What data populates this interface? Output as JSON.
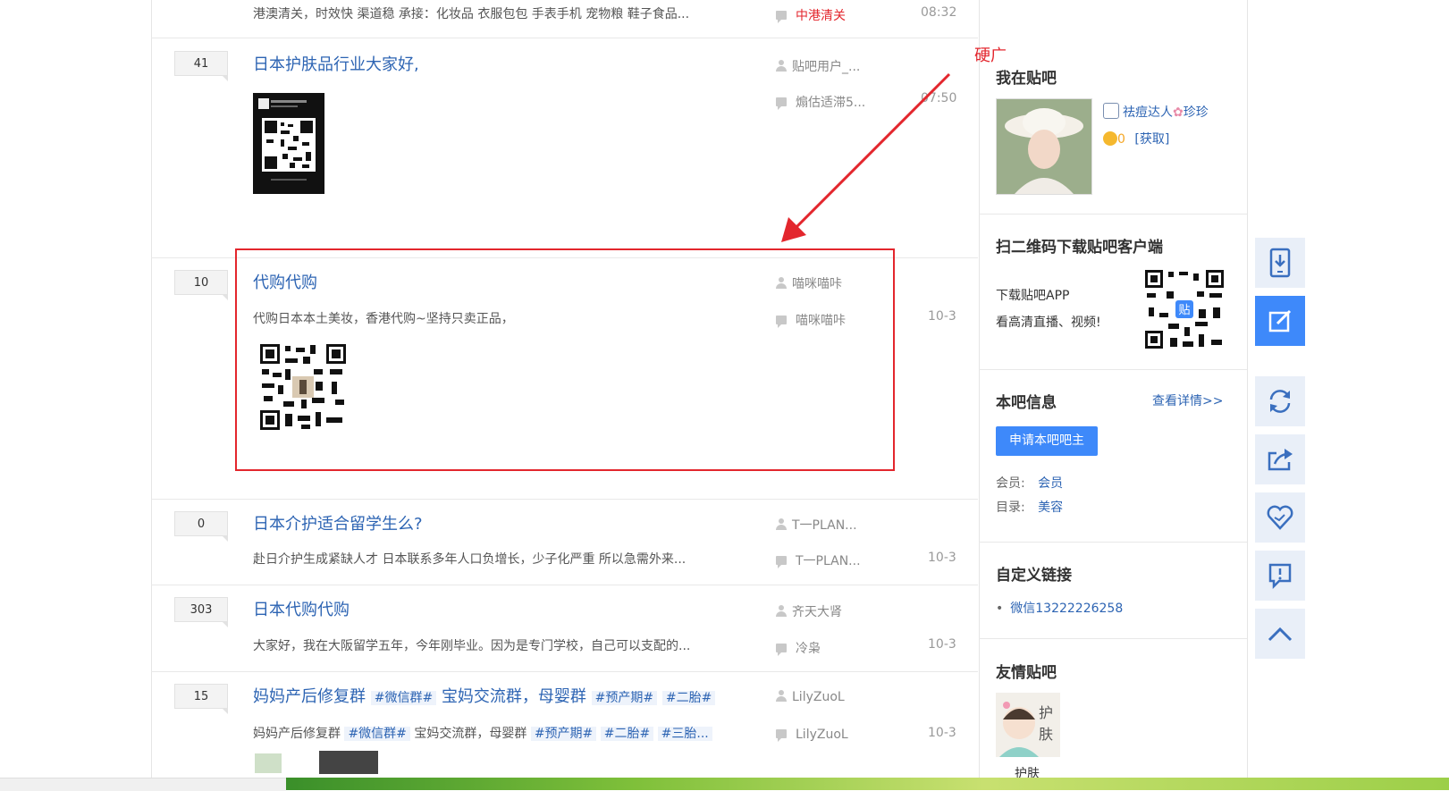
{
  "threads": [
    {
      "reply_count": "",
      "title": "",
      "abstract": "港澳清关，时效快 渠道稳 承接：化妆品 衣服包包 手表手机 宠物粮 鞋子食品...",
      "author": "",
      "last_reply": "中港清关",
      "time": "08:32"
    },
    {
      "reply_count": "41",
      "title": "日本护肤品行业大家好,",
      "abstract": "",
      "author": "贴吧用户_...",
      "last_reply": "煽估适滞5...",
      "time": "07:50"
    },
    {
      "reply_count": "10",
      "title": "代购代购",
      "abstract": "代购日本本土美妆，香港代购~坚持只卖正品，",
      "author": "喵咪喵咔",
      "last_reply": "喵咪喵咔",
      "time": "10-3"
    },
    {
      "reply_count": "0",
      "title": "日本介护适合留学生么?",
      "abstract": "赴日介护生成紧缺人才 日本联系多年人口负增长，少子化严重 所以急需外来...",
      "author": "T一PLAN...",
      "last_reply": "T一PLAN...",
      "time": "10-3"
    },
    {
      "reply_count": "303",
      "title": "日本代购代购",
      "abstract": "大家好，我在大阪留学五年，今年刚毕业。因为是专门学校，自己可以支配的...",
      "author": "齐天大肾",
      "last_reply": "冷枭",
      "time": "10-3"
    },
    {
      "reply_count": "15",
      "title": "妈妈产后修复群",
      "title_tags": [
        "#微信群#",
        "宝妈交流群，母婴群",
        "#预产期#",
        "#二胎#"
      ],
      "abstract": "妈妈产后修复群",
      "abstract_tags": [
        "#微信群#",
        "宝妈交流群，母婴群",
        "#预产期#",
        "#二胎#",
        "#三胎..."
      ],
      "author": "LilyZuoL",
      "last_reply": "LilyZuoL",
      "time": "10-3"
    }
  ],
  "annotation": {
    "label": "硬广"
  },
  "aside": {
    "my_bar": {
      "title": "我在贴吧",
      "user_name": "祛痘达人",
      "user_name_suffix": "珍珍",
      "coins": "0",
      "get_link": "[获取]"
    },
    "download": {
      "title": "扫二维码下载贴吧客户端",
      "line1": "下载贴吧APP",
      "line2": "看高清直播、视频!"
    },
    "bar_info": {
      "title": "本吧信息",
      "more": "查看详情>>",
      "apply_button": "申请本吧吧主",
      "member_label": "会员:",
      "member_value": "会员",
      "dir_label": "目录:",
      "dir_value": "美容"
    },
    "custom_links": {
      "title": "自定义链接",
      "items": [
        "微信13222226258"
      ]
    },
    "friend_bars": {
      "title": "友情贴吧",
      "items": [
        "护肤"
      ]
    }
  },
  "colors": {
    "link": "#2d64b3",
    "accent": "#3e89fa",
    "annotation": "#e3262d"
  }
}
